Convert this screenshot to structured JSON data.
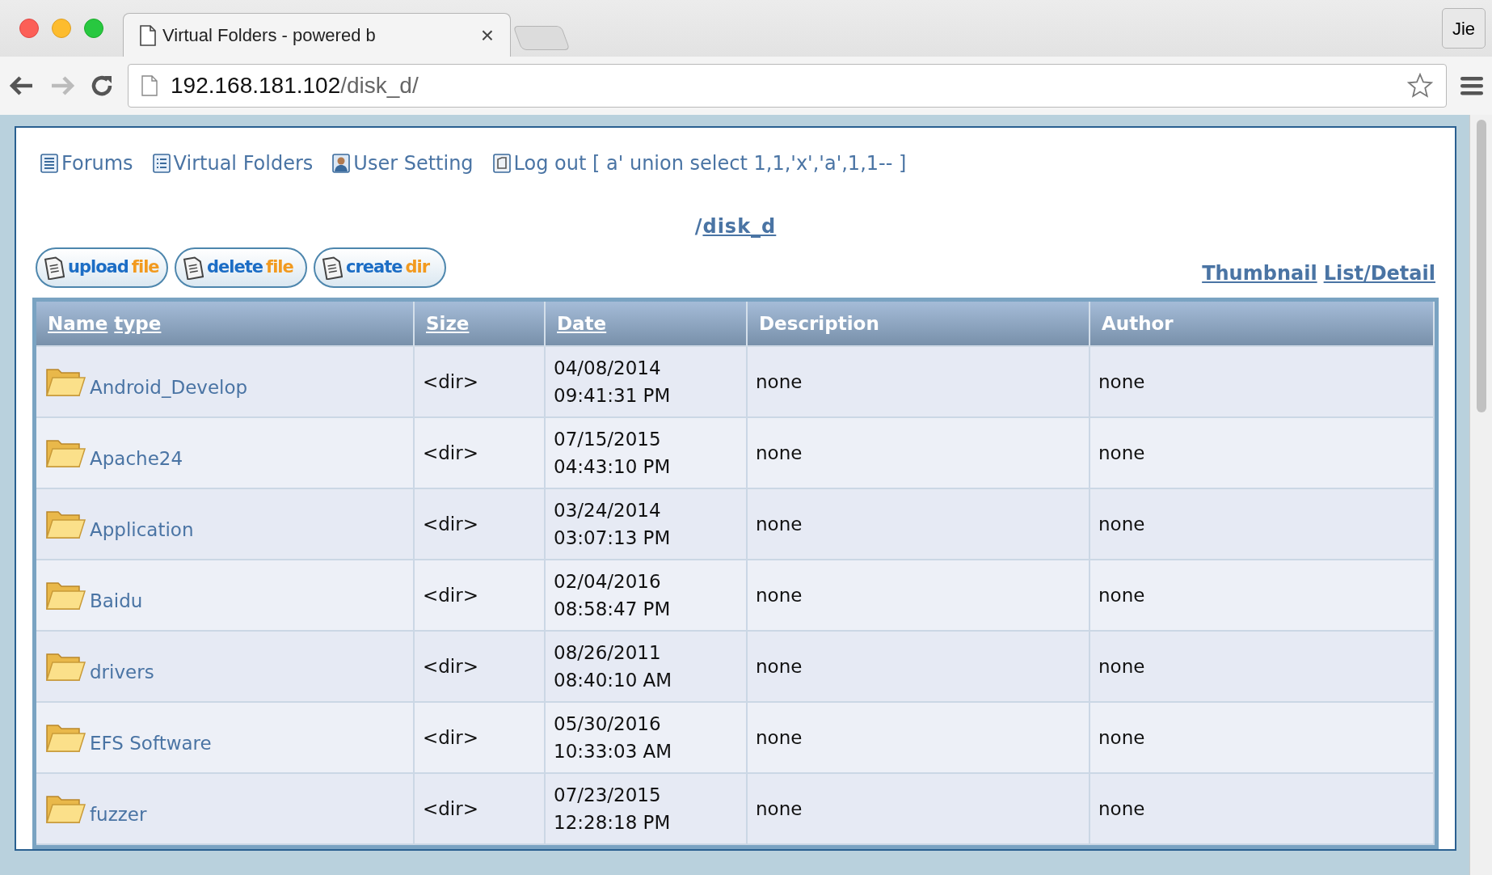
{
  "browser": {
    "tab": {
      "title": "Virtual Folders - powered b",
      "close": "×"
    },
    "profile": "Jie",
    "address": {
      "host": "192.168.181.102",
      "path": "/disk_d/"
    }
  },
  "nav": [
    {
      "kind": "forums",
      "label": "Forums"
    },
    {
      "kind": "folders",
      "label": "Virtual Folders"
    },
    {
      "kind": "user",
      "label": "User Setting"
    },
    {
      "kind": "logout",
      "label": "Log out [ a' union select 1,1,'x','a',1,1-- ]"
    }
  ],
  "path": {
    "separator": "/",
    "folder": "disk_d"
  },
  "actions": [
    {
      "main": "upload",
      "suffix": "file"
    },
    {
      "main": "delete",
      "suffix": "file"
    },
    {
      "main": "create",
      "suffix": "dir"
    }
  ],
  "views": [
    "Thumbnail",
    "List/Detail"
  ],
  "table": {
    "columns": [
      {
        "kind": "link",
        "labels": [
          "Name",
          "type"
        ]
      },
      {
        "kind": "link",
        "labels": [
          "Size"
        ]
      },
      {
        "kind": "link",
        "labels": [
          "Date"
        ]
      },
      {
        "kind": "text",
        "labels": [
          "Description"
        ]
      },
      {
        "kind": "text",
        "labels": [
          "Author"
        ]
      }
    ],
    "rows": [
      {
        "name": "Android_Develop",
        "size": "<dir>",
        "date": "04/08/2014 09:41:31 PM",
        "description": "none",
        "author": "none"
      },
      {
        "name": "Apache24",
        "size": "<dir>",
        "date": "07/15/2015 04:43:10 PM",
        "description": "none",
        "author": "none"
      },
      {
        "name": "Application",
        "size": "<dir>",
        "date": "03/24/2014 03:07:13 PM",
        "description": "none",
        "author": "none"
      },
      {
        "name": "Baidu",
        "size": "<dir>",
        "date": "02/04/2016 08:58:47 PM",
        "description": "none",
        "author": "none"
      },
      {
        "name": "drivers",
        "size": "<dir>",
        "date": "08/26/2011 08:40:10 AM",
        "description": "none",
        "author": "none"
      },
      {
        "name": "EFS Software",
        "size": "<dir>",
        "date": "05/30/2016 10:33:03 AM",
        "description": "none",
        "author": "none"
      },
      {
        "name": "fuzzer",
        "size": "<dir>",
        "date": "07/23/2015 12:28:18 PM",
        "description": "none",
        "author": "none"
      }
    ]
  }
}
